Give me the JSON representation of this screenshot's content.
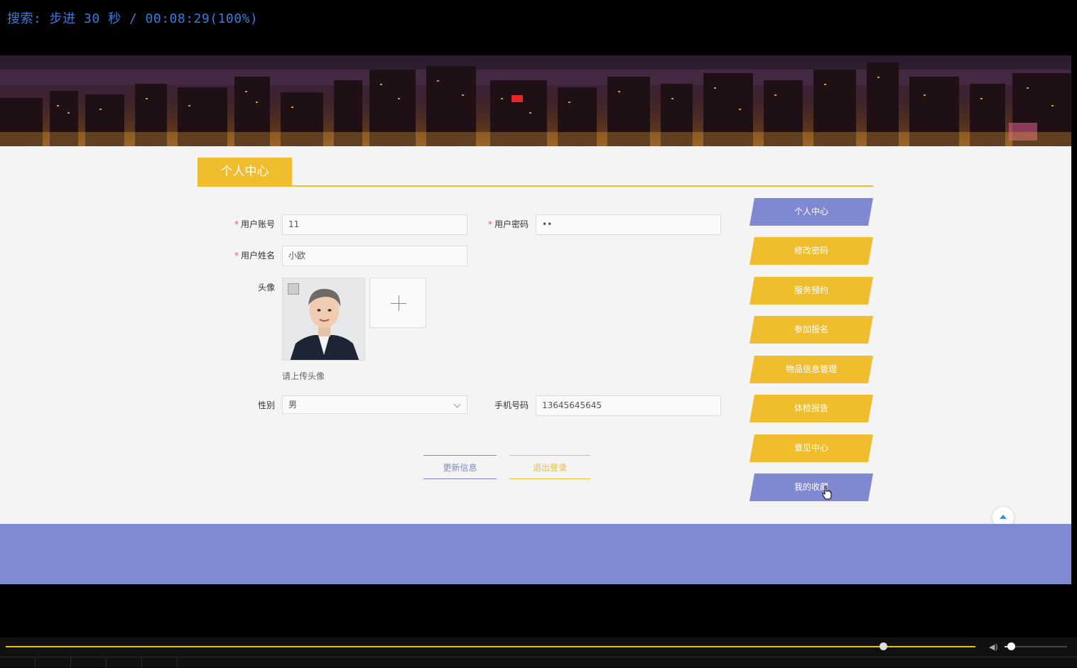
{
  "osd": {
    "text": "搜索: 步进 30 秒 / 00:08:29(100%)"
  },
  "section": {
    "title": "个人中心"
  },
  "form": {
    "account_label": "用户账号",
    "account_value": "11",
    "password_label": "用户密码",
    "password_value": "••",
    "name_label": "用户姓名",
    "name_value": "小欧",
    "avatar_label": "头像",
    "avatar_hint": "请上传头像",
    "gender_label": "性别",
    "gender_value": "男",
    "phone_label": "手机号码",
    "phone_value": "13645645645",
    "required_mark": "*"
  },
  "actions": {
    "update": "更新信息",
    "logout": "退出登录"
  },
  "sidebar": {
    "items": [
      {
        "label": "个人中心",
        "color": "#8188d2"
      },
      {
        "label": "修改密码",
        "color": "#f0bd2e"
      },
      {
        "label": "服务预约",
        "color": "#f0bd2e"
      },
      {
        "label": "参加报名",
        "color": "#f0bd2e"
      },
      {
        "label": "物品信息管理",
        "color": "#f0bd2e"
      },
      {
        "label": "体检报告",
        "color": "#f0bd2e"
      },
      {
        "label": "意见中心",
        "color": "#f0bd2e"
      },
      {
        "label": "我的收藏",
        "color": "#8188d2"
      }
    ]
  },
  "player": {
    "progress_fraction": 0.905,
    "volume_fraction": 0.1
  },
  "colors": {
    "accent_yellow": "#f0bd2e",
    "accent_purple": "#8188d2",
    "osd_blue": "#3a7be0"
  },
  "icons": [
    "plus-icon",
    "chevron-down-icon",
    "arrow-up-icon",
    "pointer-cursor-icon",
    "volume-icon"
  ]
}
